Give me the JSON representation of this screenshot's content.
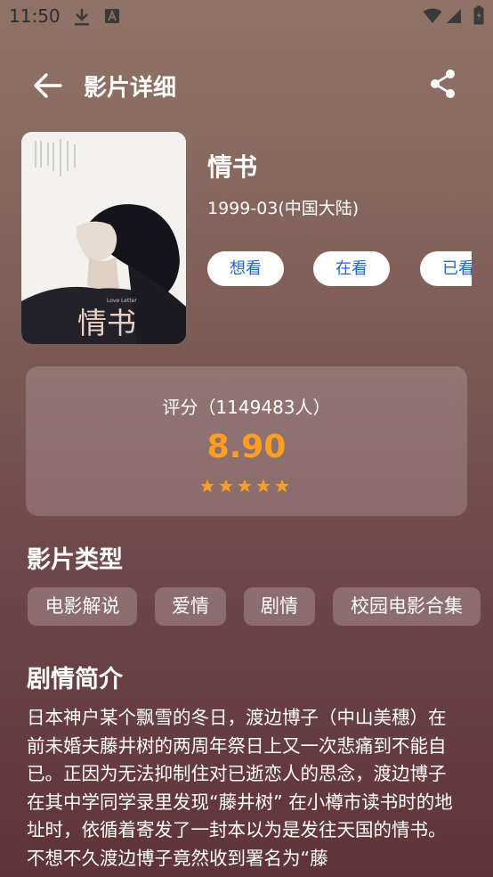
{
  "status_bar": {
    "time": "11:50",
    "icons": [
      "download-icon",
      "a-icon",
      "wifi-icon",
      "signal-icon",
      "battery-icon"
    ]
  },
  "header": {
    "title": "影片详细",
    "back_icon": "arrow-left-icon",
    "share_icon": "share-icon"
  },
  "movie": {
    "title": "情书",
    "release": "1999-03(中国大陆)",
    "poster": {
      "title_text": "情书",
      "subtitle_text": "Love Letter"
    },
    "actions": [
      {
        "label": "想看"
      },
      {
        "label": "在看"
      },
      {
        "label": "已看"
      }
    ]
  },
  "rating": {
    "label": "评分（1149483人）",
    "score": "8.90",
    "stars": 5,
    "score_color": "#ff9f22"
  },
  "genre": {
    "heading": "影片类型",
    "tags": [
      "电影解说",
      "爱情",
      "剧情",
      "校园电影合集"
    ]
  },
  "synopsis": {
    "heading": "剧情简介",
    "text": "日本神户某个飘雪的冬日，渡边博子（中山美穗）在前未婚夫藤井树的两周年祭日上又一次悲痛到不能自已。正因为无法抑制住对已逝恋人的思念，渡边博子在其中学同学录里发现“藤井树” 在小樽市读书时的地址时，依循着寄发了一封本以为是发往天国的情书。 不想不久渡边博子竟然收到署名为“藤"
  },
  "colors": {
    "accent_blue": "#1f66d8",
    "rating_orange": "#ff9f22"
  }
}
